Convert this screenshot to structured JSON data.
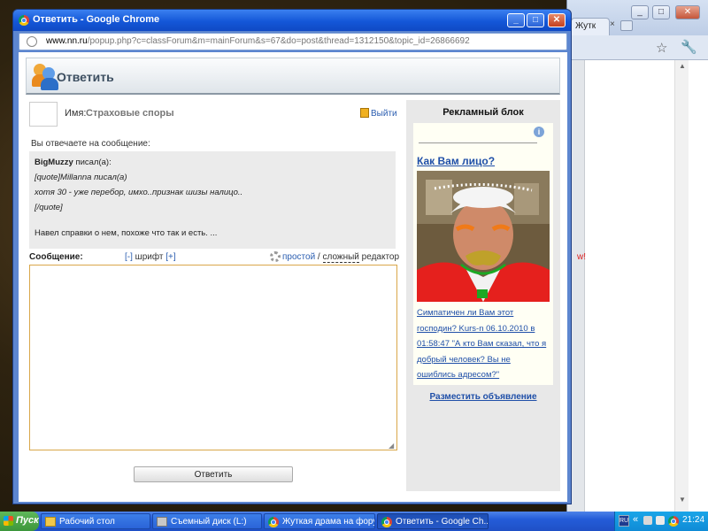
{
  "background_window": {
    "tab_label": "Жутк",
    "tab_close": "×",
    "right_edge_text": "w!"
  },
  "popup": {
    "window_title": "Ответить - Google Chrome",
    "url_host": "www.nn.ru",
    "url_path": "/popup.php?c=classForum&m=mainForum&s=67&do=post&thread=1312150&topic_id=26866692",
    "page_title": "Ответить",
    "name_label": "Имя:",
    "name_value": "Страховые споры",
    "logout_label": "Выйти",
    "reply_to_label": "Вы отвечаете на сообщение:",
    "quote": {
      "author": "BigMuzzy",
      "wrote": " писал(а):",
      "line1": "[quote]Millanna писал(а)",
      "line2": "хотя 30 - уже перебор, имхо..признак шизы налицо..",
      "line3": "[/quote]",
      "line4": "Навел справки о нем, похоже что так и есть. ..."
    },
    "message_label": "Сообщение:",
    "font_minus": "[-]",
    "font_label": " шрифт ",
    "font_plus": "[+]",
    "editor_simple": "простой",
    "editor_sep": " / ",
    "editor_complex": "сложный",
    "editor_word": " редактор",
    "submit_label": "Ответить",
    "ad": {
      "heading": "Рекламный блок",
      "info": "i",
      "title": "Как Вам лицо?",
      "text": "Симпатичен ли Вам этот господин? Kurs-n 06.10.2010 в 01:58:47 \"А кто Вам сказал, что я добрый человек? Вы не ошиблись адресом?\"",
      "place_link": "Разместить объявление"
    }
  },
  "taskbar": {
    "start_label": "Пуск",
    "tasks": [
      {
        "label": "Рабочий стол"
      },
      {
        "label": "Съемный диск (L:)"
      },
      {
        "label": "Жуткая драма на фору..."
      },
      {
        "label": "Ответить - Google Ch..."
      }
    ],
    "lang": "RU",
    "tray_arrow": "«",
    "clock": "21:24"
  }
}
